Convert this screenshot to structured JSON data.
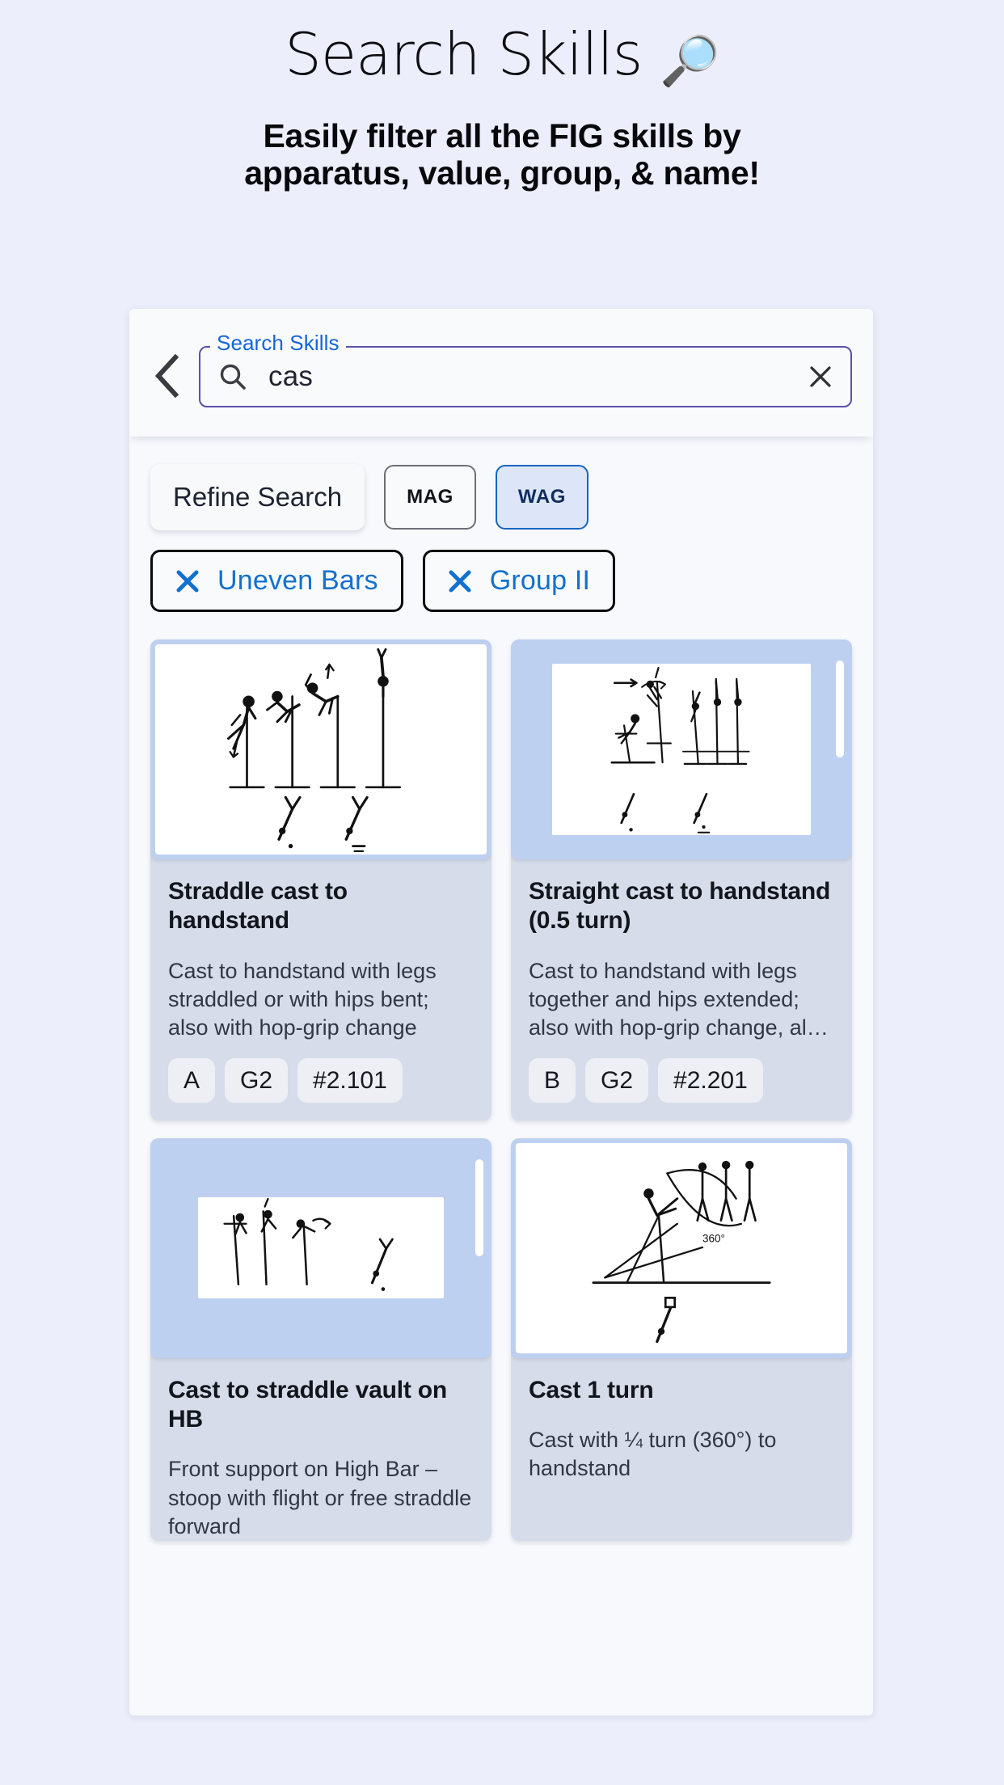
{
  "hero": {
    "title": "Search Skills",
    "title_icon": "magnifying-glass-emoji",
    "subtitle_line1": "Easily filter all the FIG skills by",
    "subtitle_line2": "apparatus, value, group, & name!"
  },
  "search": {
    "legend": "Search Skills",
    "value": "cas",
    "placeholder": "Search Skills",
    "back_icon": "chevron-left-icon",
    "search_icon": "search-icon",
    "clear_icon": "close-icon"
  },
  "filters": {
    "refine_label": "Refine Search",
    "segments": [
      {
        "label": "MAG",
        "selected": false
      },
      {
        "label": "WAG",
        "selected": true
      }
    ],
    "chips": [
      {
        "label": "Uneven Bars",
        "remove_icon": "close-icon"
      },
      {
        "label": "Group II",
        "remove_icon": "close-icon"
      }
    ]
  },
  "colors": {
    "page_bg": "#eceefb",
    "accent_blue": "#1270cf",
    "selected_border": "#1565c0",
    "selected_fill": "#dde6f8",
    "field_border": "#5b50a8",
    "legend_blue": "#1565d8",
    "card_bg": "#d6dce9",
    "thumb_bg": "#bed0f0"
  },
  "results": [
    {
      "title": "Straddle cast to handstand",
      "description": "Cast to handstand with legs straddled or with hips bent; also with hop-grip change",
      "badges": [
        "A",
        "G2",
        "#2.101"
      ],
      "thumb": "straddle-cast-figure",
      "thumb_style": "white-fill",
      "scrollbar": false
    },
    {
      "title": "Straight cast to handstand (0.5 turn)",
      "description": "Cast to handstand with legs together and hips extended; also with hop-grip change, also with ½...",
      "badges": [
        "B",
        "G2",
        "#2.201"
      ],
      "thumb": "straight-cast-half-turn-figure",
      "thumb_style": "inset",
      "scrollbar": true
    },
    {
      "title": "Cast to straddle vault on HB",
      "description": "Front support on High Bar – stoop with flight or free straddle forward",
      "badges": [],
      "thumb": "cast-straddle-vault-figure",
      "thumb_style": "inset-wide",
      "scrollbar": true
    },
    {
      "title": "Cast 1 turn",
      "description": "Cast with ¼ turn (360°) to handstand",
      "badges": [],
      "thumb": "cast-one-turn-figure",
      "thumb_style": "white-fill",
      "scrollbar": false
    }
  ]
}
